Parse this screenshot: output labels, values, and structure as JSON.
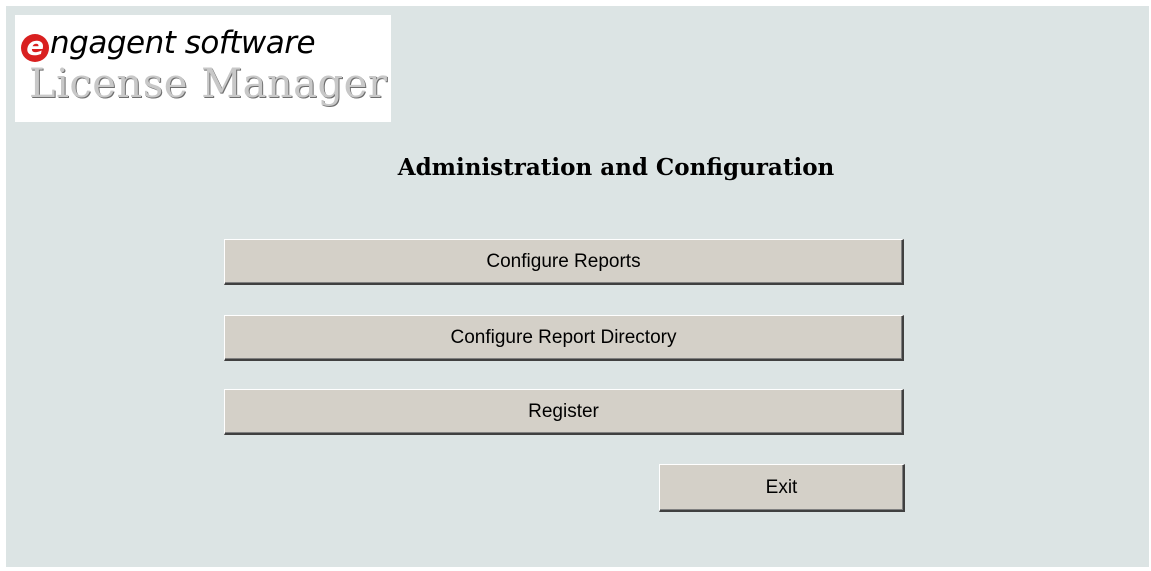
{
  "logo": {
    "brand_initial": "e",
    "brand_rest": "ngagent software",
    "product_name": "License Manager"
  },
  "page_title": "Administration and Configuration",
  "buttons": {
    "configure_reports": "Configure Reports",
    "configure_report_directory": "Configure Report Directory",
    "register": "Register",
    "exit": "Exit"
  },
  "colors": {
    "background": "#dce4e4",
    "button_face": "#d4d0c8",
    "logo_accent": "#d92020"
  }
}
